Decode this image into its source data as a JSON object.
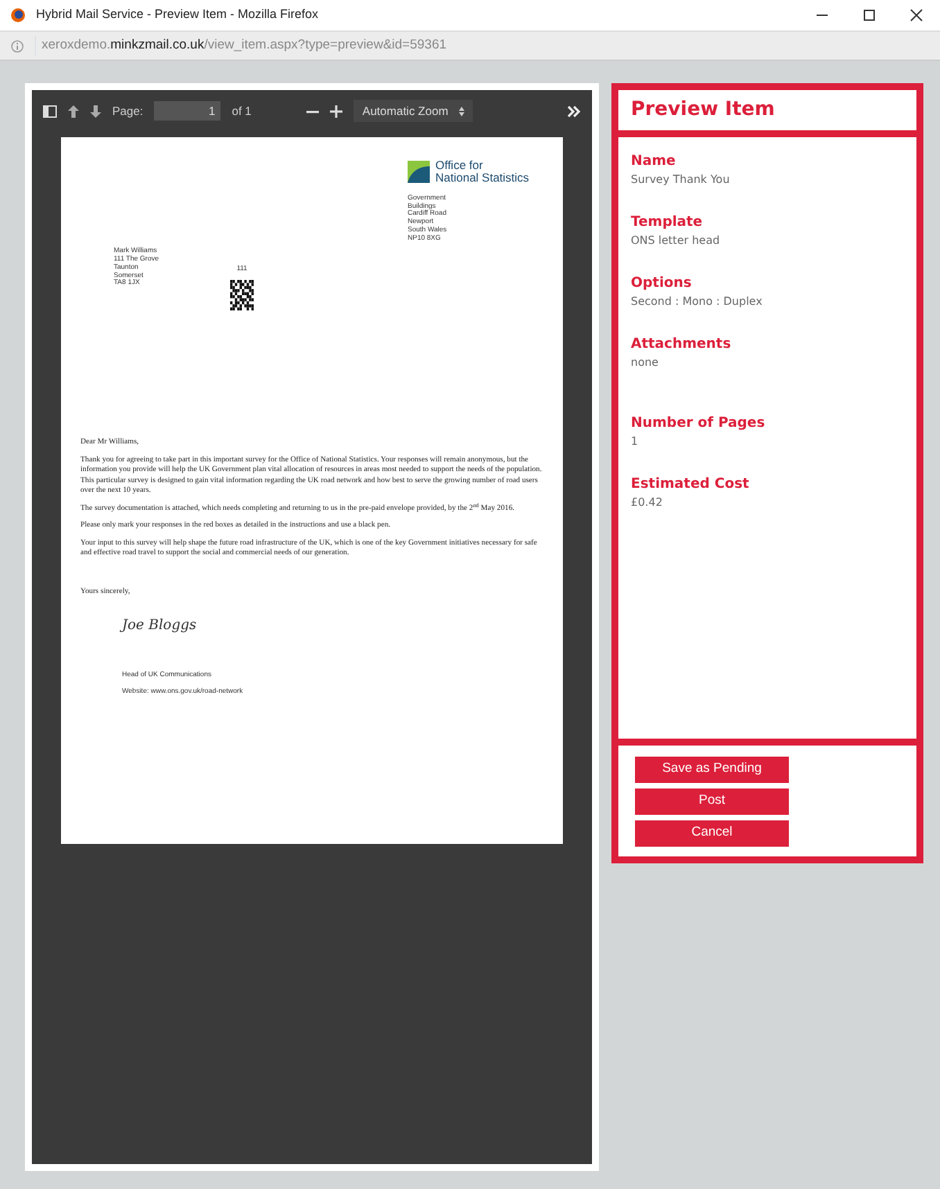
{
  "window": {
    "title": "Hybrid Mail Service - Preview Item - Mozilla Firefox",
    "url": "xeroxdemo.**minkzmail.co.uk**/view_item.aspx?type=preview&id=59361"
  },
  "pdf_toolbar": {
    "page_label": "Page:",
    "page_value": "1",
    "page_count": "of 1",
    "zoom": "Automatic Zoom"
  },
  "letter": {
    "logo_lines": [
      "Office for",
      "National Statistics"
    ],
    "sender_address": [
      "Government",
      "Buildings",
      "Cardiff Road",
      "Newport",
      "South Wales",
      "NP10 8XG"
    ],
    "recipient_address": [
      "Mark Williams",
      "111 The Grove",
      "Taunton",
      "Somerset",
      "TA8 1JX"
    ],
    "reference": "111",
    "salutation": "Dear Mr Williams,",
    "paragraphs": [
      "Thank you for agreeing to take part in this important survey for the Office of National Statistics. Your responses will remain anonymous, but the information you provide will help the UK Government plan vital allocation of resources in areas most needed to support the needs of the population. This particular survey is designed to gain vital information regarding the UK road network and how best to serve the growing number of road users over the next 10 years.",
      "The survey documentation is attached, which needs completing and returning to us in the pre-paid envelope provided, by the 2$^{nd}$ May 2016.",
      "Please only mark your responses in the red boxes as detailed in the instructions and use a black pen.",
      "Your input to this survey will help shape the future road infrastructure of the UK, which is one of the key Government initiatives necessary for safe and effective road travel to support the social and commercial needs of our generation."
    ],
    "closing": "Yours sincerely,",
    "signature": "Joe Bloggs",
    "signatory_title": "Head of UK Communications",
    "website": "Website: www.ons.gov.uk/road-network"
  },
  "panel": {
    "title": "Preview Item",
    "fields": [
      {
        "label": "Name",
        "value": "Survey Thank You"
      },
      {
        "label": "Template",
        "value": "ONS letter head"
      },
      {
        "label": "Options",
        "value": "Second : Mono : Duplex"
      },
      {
        "label": "Attachments",
        "value": "none"
      },
      {
        "label": "Number of Pages",
        "value": "1"
      },
      {
        "label": "Estimated Cost",
        "value": "£0.42"
      }
    ],
    "buttons": [
      "Save as Pending",
      "Post",
      "Cancel"
    ]
  }
}
